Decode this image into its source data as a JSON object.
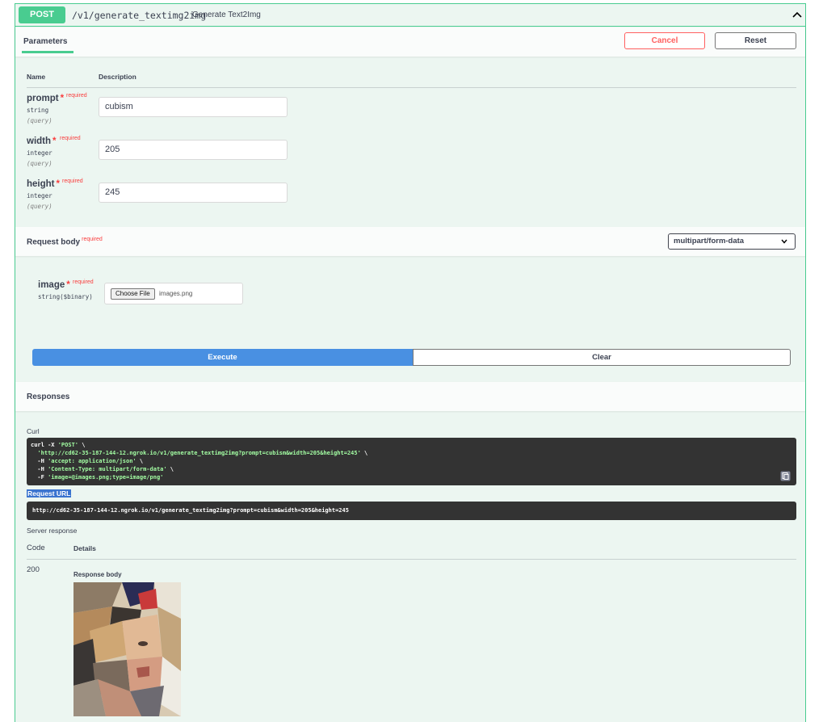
{
  "operation": {
    "method": "POST",
    "path": "/v1/generate_textimg2img",
    "summary": "Generate Text2Img",
    "collapse_icon": "chevron-up-icon"
  },
  "parameters_tab": {
    "label": "Parameters",
    "cancel_label": "Cancel",
    "reset_label": "Reset"
  },
  "columns": {
    "name": "Name",
    "description": "Description"
  },
  "params": [
    {
      "name": "prompt",
      "star": "*",
      "required": "required",
      "type": "string",
      "in": "(query)",
      "value": "cubism"
    },
    {
      "name": "width",
      "star": "*",
      "required": "required",
      "type": "integer",
      "in": "(query)",
      "value": "205"
    },
    {
      "name": "height",
      "star": "*",
      "required": "required",
      "type": "integer",
      "in": "(query)",
      "value": "245"
    }
  ],
  "request_body": {
    "title": "Request body",
    "required": "required",
    "content_type": "multipart/form-data",
    "field": {
      "name": "image",
      "star": "*",
      "required": "required",
      "type": "string($binary)",
      "button_label": "Choose File",
      "file_name": "images.png"
    }
  },
  "actions": {
    "execute_label": "Execute",
    "clear_label": "Clear"
  },
  "responses": {
    "title": "Responses",
    "curl_label": "Curl",
    "curl_lines": [
      {
        "pre": "curl -X ",
        "str": "'POST'",
        "post": " \\"
      },
      {
        "pre": "  ",
        "str": "'http://cd62-35-187-144-12.ngrok.io/v1/generate_textimg2img?prompt=cubism&width=205&height=245'",
        "post": " \\"
      },
      {
        "pre": "  -H ",
        "str": "'accept: application/json'",
        "post": " \\"
      },
      {
        "pre": "  -H ",
        "str": "'Content-Type: multipart/form-data'",
        "post": " \\"
      },
      {
        "pre": "  -F ",
        "str": "'image=@images.png;type=image/png'",
        "post": ""
      }
    ],
    "request_url_label": "Request URL",
    "request_url": "http://cd62-35-187-144-12.ngrok.io/v1/generate_textimg2img?prompt=cubism&width=205&height=245",
    "server_response_label": "Server response",
    "code_header": "Code",
    "details_header": "Details",
    "code": "200",
    "response_body_label": "Response body"
  },
  "colors": {
    "post_green": "#49cc90",
    "execute_blue": "#4990e2",
    "required_red": "#f93e3e",
    "code_bg": "#333333",
    "code_string": "#a2fca2"
  }
}
